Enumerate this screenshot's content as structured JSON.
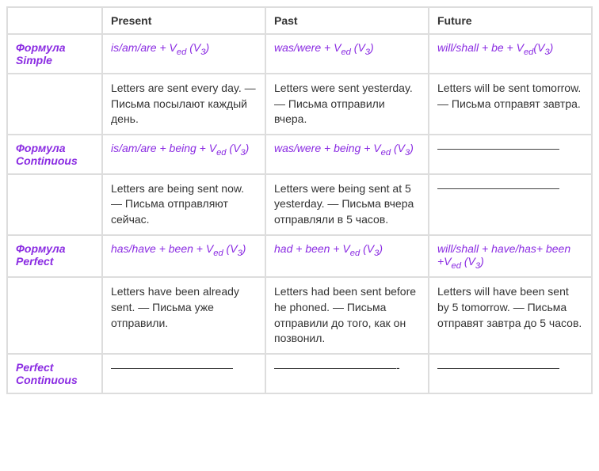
{
  "headers": {
    "blank": "",
    "present": "Present",
    "past": "Past",
    "future": "Future"
  },
  "rows": {
    "simple_formula_label": "Формула Simple",
    "simple_formula": {
      "present_pre": "is/am/are + V",
      "present_sub": "ed",
      "present_post": " (V",
      "present_sub2": "3",
      "present_end": ")",
      "past_pre": "was/were + V",
      "past_sub": "ed",
      "past_post": " (V",
      "past_sub2": "3",
      "past_end": ")",
      "future_pre": "will/shall + be + V",
      "future_sub": "ed",
      "future_post": "(V",
      "future_sub2": "3",
      "future_end": ")"
    },
    "simple_example": {
      "present": " Letters are sent every day. — Письма посылают каждый день.",
      "past": " Letters were sent yesterday. — Письма отправили вчера.",
      "future": " Letters will be sent tomorrow. — Письма отправят завтра."
    },
    "continuous_formula_label": "Формула Continuous",
    "continuous_formula": {
      "present_pre": "is/am/are + being + V",
      "present_sub": "ed",
      "present_post": " (V",
      "present_sub2": "3",
      "present_end": ")",
      "past_pre": "was/were + being + V",
      "past_sub": "ed",
      "past_post": " (V",
      "past_sub2": "3",
      "past_end": ")",
      "future": "———————————"
    },
    "continuous_example": {
      "present": " Letters are being sent now. — Письма отправляют сейчас.",
      "past": " Letters were being sent at 5 yesterday. — Письма вчера отправляли в 5 часов.",
      "future": "———————————"
    },
    "perfect_formula_label": "Формула Perfect",
    "perfect_formula": {
      "present_pre": "has/have + been + V",
      "present_sub": "ed",
      "present_post": " (V",
      "present_sub2": "3",
      "present_end": ")",
      "past_pre": "had + been + V",
      "past_sub": "ed",
      "past_post": " (V",
      "past_sub2": "3",
      "past_end": ")",
      "future_pre": " will/shall + have/has+ been +V",
      "future_sub": "ed",
      "future_post": " (V",
      "future_sub2": "3",
      "future_end": ")"
    },
    "perfect_example": {
      "present": "  Letters have been already sent. — Письма уже отправили.",
      "past": " Letters had been sent before he phoned. — Письма отправили до того, как он позвонил.",
      "future": "  Letters will have been sent by 5 tomorrow. — Письма отправят завтра до 5 часов."
    },
    "perfect_continuous_label": "Perfect Continuous",
    "perfect_continuous": {
      "present": "———————————",
      "past": "———————————-",
      "future": "———————————"
    }
  }
}
